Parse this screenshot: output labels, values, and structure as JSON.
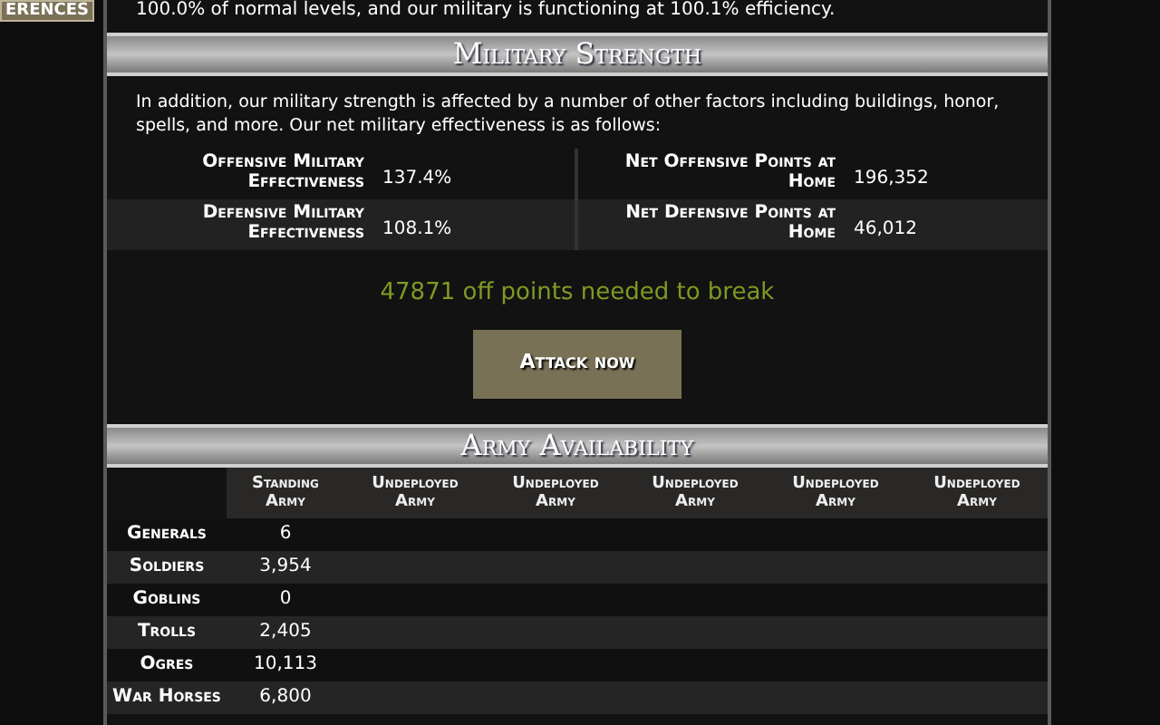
{
  "side_button": {
    "label": "ERENCES"
  },
  "top_text": "100.0% of normal levels, and our military is functioning at 100.1% efficiency.",
  "military_strength": {
    "title": "Military Strength",
    "intro": "In addition, our military strength is affected by a number of other factors including buildings, honor, spells, and more. Our net military effectiveness is as follows:",
    "stats": [
      {
        "label": "Offensive Military Effectiveness",
        "value": "137.4%",
        "label_2": "Net Offensive Points at Home",
        "value_2": "196,352"
      },
      {
        "label": "Defensive Military Effectiveness",
        "value": "108.1%",
        "label_2": "Net Defensive Points at Home",
        "value_2": "46,012"
      }
    ],
    "break_message": "47871 off points needed to break",
    "attack_button": "Attack now"
  },
  "army_availability": {
    "title": "Army Availability",
    "columns": [
      "Standing Army",
      "Undeployed Army",
      "Undeployed Army",
      "Undeployed Army",
      "Undeployed Army",
      "Undeployed Army"
    ],
    "rows": [
      {
        "unit": "Generals",
        "standing": "6"
      },
      {
        "unit": "Soldiers",
        "standing": "3,954"
      },
      {
        "unit": "Goblins",
        "standing": "0"
      },
      {
        "unit": "Trolls",
        "standing": "2,405"
      },
      {
        "unit": "Ogres",
        "standing": "10,113"
      },
      {
        "unit": "War Horses",
        "standing": "6,800"
      }
    ]
  }
}
